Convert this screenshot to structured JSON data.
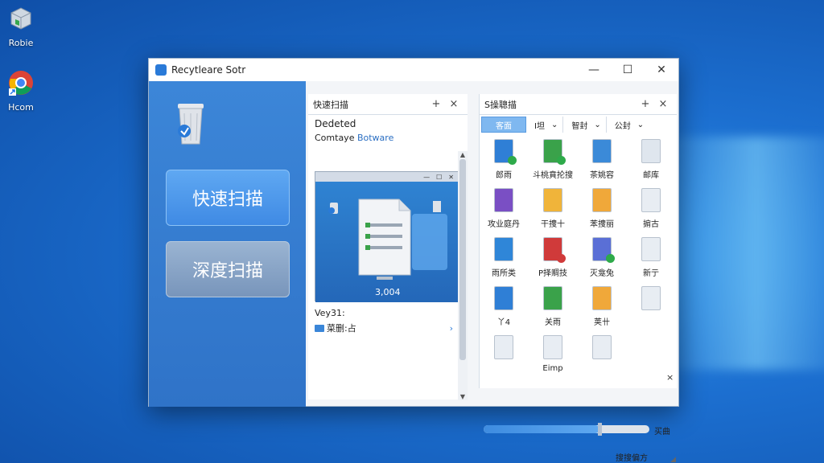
{
  "desktop": {
    "icons": [
      {
        "label": "Robie"
      },
      {
        "label": "Hcom"
      }
    ]
  },
  "window": {
    "title": "Recytleare Sotr",
    "controls": {
      "minimize": "—",
      "maximize": "☐",
      "close": "✕"
    }
  },
  "left": {
    "quick_scan": "快速扫描",
    "deep_scan": "深度扫描"
  },
  "middle": {
    "tab_label": "快速扫描",
    "add": "+",
    "close": "×",
    "deleted": "Dedeted",
    "sub_prefix": "Comtaye ",
    "sub_highlight": "Botware",
    "preview_value": "3,004",
    "list_heading": "Vey31:",
    "list_item": "菜删:占",
    "list_chevron": "›"
  },
  "right": {
    "tab_label": "S操聰描",
    "add": "+",
    "close": "×",
    "filters": [
      {
        "label": "客面"
      },
      {
        "label": "I坦",
        "arrow": "⌄"
      },
      {
        "label": "智封",
        "arrow": "⌄"
      },
      {
        "label": "公封",
        "arrow": "⌄"
      }
    ],
    "files": [
      {
        "label": "郎雨",
        "color": "#2f7fd6"
      },
      {
        "label": "斗桃賁抡搜",
        "color": "#3aa24a"
      },
      {
        "label": "茶姚容",
        "color": "#3b8ad8"
      },
      {
        "label": "邮库",
        "color": "#dfe6ee"
      },
      {
        "label": "攻业庭丹",
        "color": "#7a4fc4"
      },
      {
        "label": "干捜十",
        "color": "#f0b43a"
      },
      {
        "label": "苯捜丽",
        "color": "#f0a83a"
      },
      {
        "label": "掮古",
        "color": "#e8edf3"
      },
      {
        "label": "雨所类",
        "color": "#2f86d8"
      },
      {
        "label": "P择赒技",
        "color": "#d03a3a"
      },
      {
        "label": "灭龛兔",
        "color": "#5a6fd6"
      },
      {
        "label": "新亍",
        "color": "#e8edf3"
      },
      {
        "label": "丫4",
        "color": "#2f7fd6"
      },
      {
        "label": "关雨",
        "color": "#3aa24a"
      },
      {
        "label": "荚卄",
        "color": "#f0a83a"
      },
      {
        "label": "",
        "color": "#e8edf3"
      },
      {
        "label": "",
        "color": "#e8edf3"
      },
      {
        "label": "Eimp",
        "color": "#e8edf3"
      },
      {
        "label": "",
        "color": "#e8edf3"
      }
    ],
    "close_small": "×",
    "slider_progress": 0.7,
    "slider_label": "买曲"
  },
  "status": {
    "text": "搜搜偏方",
    "grip": "◢"
  }
}
